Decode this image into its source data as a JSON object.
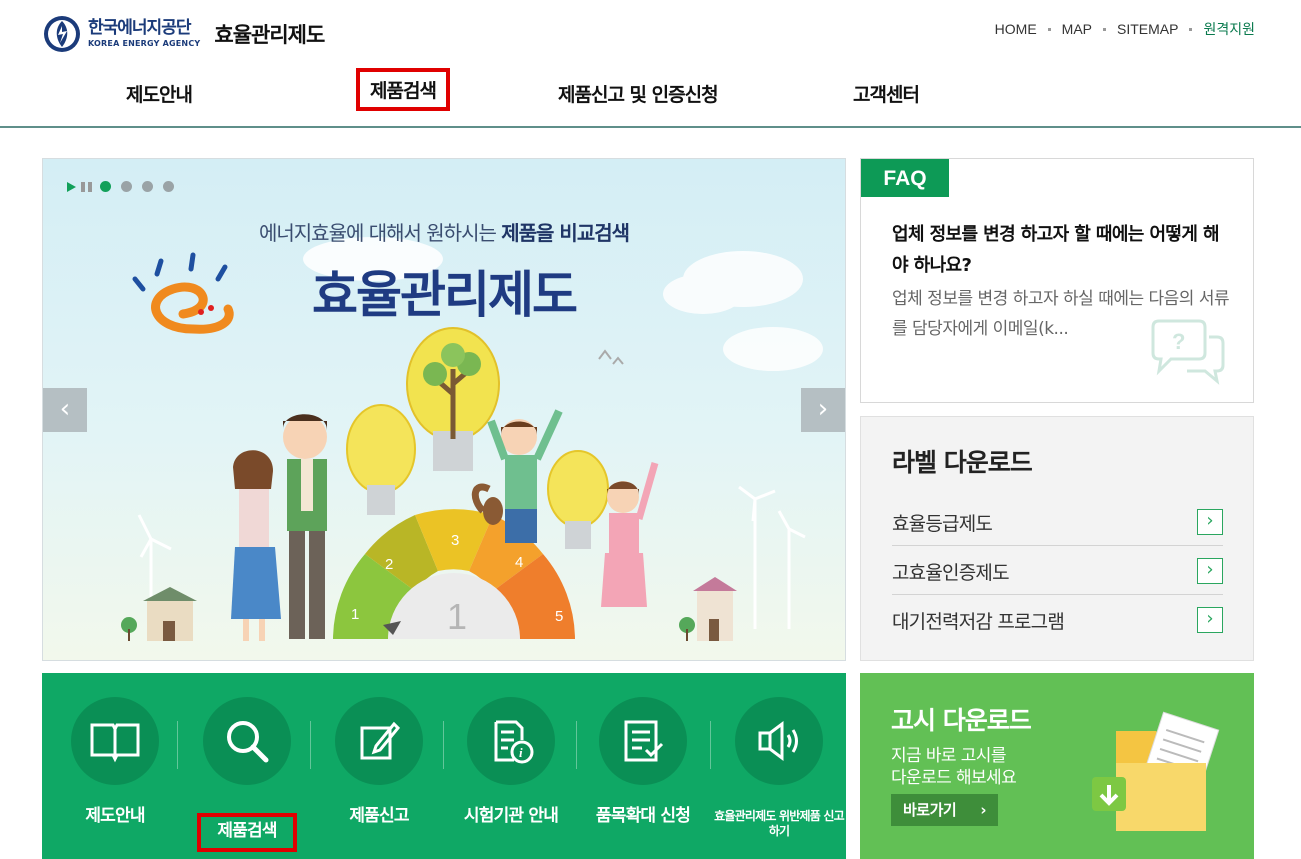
{
  "header": {
    "logo_ko": "한국에너지공단",
    "logo_en": "KOREA ENERGY AGENCY",
    "site_title": "효율관리제도",
    "util_links": [
      "HOME",
      "MAP",
      "SITEMAP",
      "원격지원"
    ]
  },
  "gnb": {
    "items": [
      "제도안내",
      "제품검색",
      "제품신고 및 인증신청",
      "고객센터"
    ],
    "highlighted_index": 1
  },
  "hero": {
    "tagline_plain": "에너지효율에 대해서 원하시는 ",
    "tagline_bold": "제품을 비교검색",
    "title": "효율관리제도",
    "slide_count": 4,
    "active_slide": 0,
    "gauge_numbers": [
      "1",
      "2",
      "3",
      "4",
      "5"
    ],
    "dial_number": "1",
    "prev_symbol": "‹",
    "next_symbol": "›"
  },
  "faq": {
    "tab": "FAQ",
    "question": "업체 정보를 변경 하고자 할 때에는 어떻게 해야 하나요?",
    "answer": "업체 정보를 변경 하고자 하실 때에는 다음의 서류를 담당자에게 이메일(k..."
  },
  "label_download": {
    "title": "라벨 다운로드",
    "items": [
      "효율등급제도",
      "고효율인증제도",
      "대기전력저감 프로그램"
    ],
    "button_symbol": "›"
  },
  "quick_menu": {
    "items": [
      {
        "label": "제도안내",
        "icon": "book-icon"
      },
      {
        "label": "제품검색",
        "icon": "magnifier-icon"
      },
      {
        "label": "제품신고",
        "icon": "pen-document-icon"
      },
      {
        "label": "시험기관 안내",
        "icon": "document-info-icon"
      },
      {
        "label": "품목확대 신청",
        "icon": "checklist-icon"
      },
      {
        "label": "효율관리제도 위반제품 신고하기",
        "icon": "megaphone-icon"
      }
    ],
    "highlighted_index": 1
  },
  "notice_download": {
    "title": "고시 다운로드",
    "desc_line1": "지금 바로 고시를",
    "desc_line2": "다운로드 해보세요",
    "button": "바로가기",
    "button_symbol": "›"
  },
  "colors": {
    "brand_green": "#0fa865",
    "faq_green": "#0d9a56",
    "notice_green": "#62c055",
    "highlight_red": "#e00000",
    "title_navy": "#1f3b82"
  }
}
